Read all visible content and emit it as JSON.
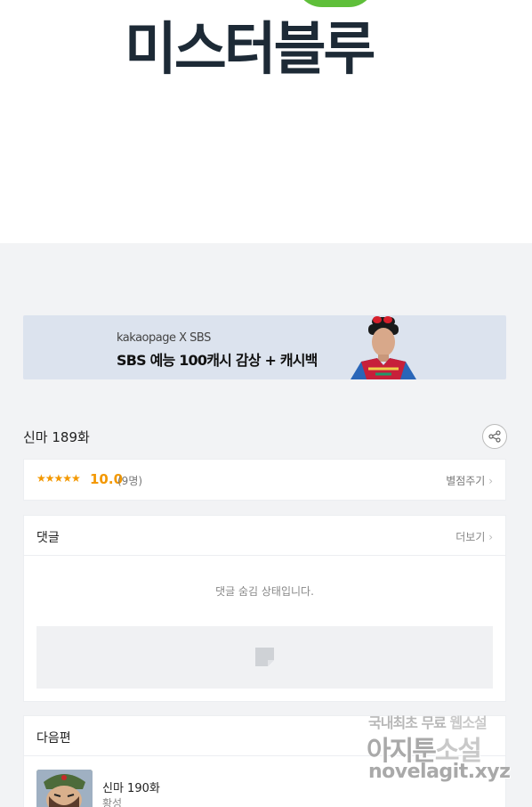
{
  "comic": {
    "title_art": "미스터블루"
  },
  "banner": {
    "sub": "kakaopage X SBS",
    "main": "SBS 예능 100캐시 감상 + 캐시백"
  },
  "episode": {
    "title": "신마 189화"
  },
  "rating": {
    "stars": "★★★★★",
    "score": "10.0",
    "count": "(9명)",
    "rate_link": "별점주기"
  },
  "comments": {
    "heading": "댓글",
    "more": "더보기",
    "hidden_notice": "댓글 숨김 상태입니다."
  },
  "next": {
    "heading": "다음편",
    "title": "신마 190화",
    "author": "황성"
  },
  "watermark": {
    "line1a": "국내최초 무료 ",
    "line1b": "웹소설",
    "line2a": "아지툰",
    "line2b": "소설",
    "line3": "novelagit.xyz"
  },
  "colors": {
    "accent_orange": "#f39800",
    "page_bg": "#f2f3f5"
  }
}
